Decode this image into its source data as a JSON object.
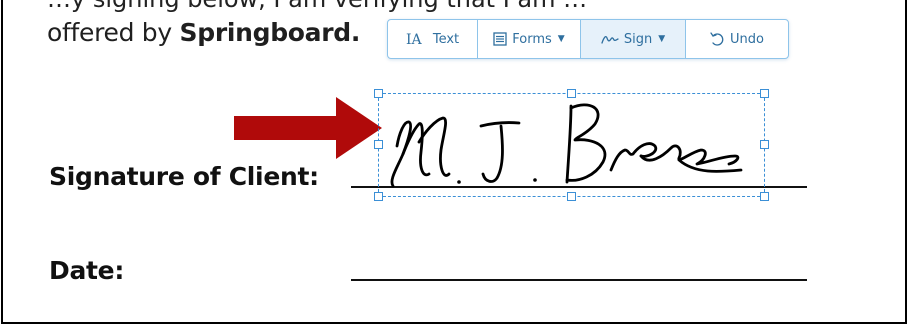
{
  "document": {
    "clipped_text": "…y signing below, I am verifying that I am …",
    "offered_prefix": "offered by ",
    "offered_bold": "Springboard.",
    "signature_label": "Signature of Client:",
    "date_label": "Date:"
  },
  "toolbar": {
    "text_label": "Text",
    "text_icon_glyph": "IA",
    "forms_label": "Forms",
    "sign_label": "Sign",
    "undo_label": "Undo"
  },
  "colors": {
    "toolbar_accent": "#2f6f9f",
    "toolbar_border": "#8ec4ea",
    "selection_border": "#3b8fd6",
    "arrow": "#b00a0a"
  },
  "icons": {
    "text": "text-cursor-icon",
    "forms": "form-icon",
    "sign": "signature-icon",
    "undo": "undo-icon",
    "caret": "caret-down-icon"
  }
}
